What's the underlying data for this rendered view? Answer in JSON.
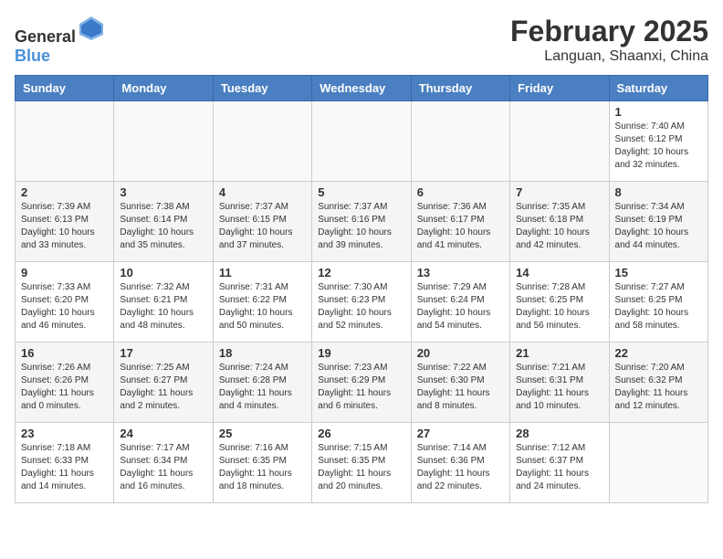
{
  "header": {
    "logo_general": "General",
    "logo_blue": "Blue",
    "title": "February 2025",
    "subtitle": "Languan, Shaanxi, China"
  },
  "weekdays": [
    "Sunday",
    "Monday",
    "Tuesday",
    "Wednesday",
    "Thursday",
    "Friday",
    "Saturday"
  ],
  "weeks": [
    [
      {
        "day": "",
        "sunrise": "",
        "sunset": "",
        "daylight": ""
      },
      {
        "day": "",
        "sunrise": "",
        "sunset": "",
        "daylight": ""
      },
      {
        "day": "",
        "sunrise": "",
        "sunset": "",
        "daylight": ""
      },
      {
        "day": "",
        "sunrise": "",
        "sunset": "",
        "daylight": ""
      },
      {
        "day": "",
        "sunrise": "",
        "sunset": "",
        "daylight": ""
      },
      {
        "day": "",
        "sunrise": "",
        "sunset": "",
        "daylight": ""
      },
      {
        "day": "1",
        "sunrise": "Sunrise: 7:40 AM",
        "sunset": "Sunset: 6:12 PM",
        "daylight": "Daylight: 10 hours and 32 minutes."
      }
    ],
    [
      {
        "day": "2",
        "sunrise": "Sunrise: 7:39 AM",
        "sunset": "Sunset: 6:13 PM",
        "daylight": "Daylight: 10 hours and 33 minutes."
      },
      {
        "day": "3",
        "sunrise": "Sunrise: 7:38 AM",
        "sunset": "Sunset: 6:14 PM",
        "daylight": "Daylight: 10 hours and 35 minutes."
      },
      {
        "day": "4",
        "sunrise": "Sunrise: 7:37 AM",
        "sunset": "Sunset: 6:15 PM",
        "daylight": "Daylight: 10 hours and 37 minutes."
      },
      {
        "day": "5",
        "sunrise": "Sunrise: 7:37 AM",
        "sunset": "Sunset: 6:16 PM",
        "daylight": "Daylight: 10 hours and 39 minutes."
      },
      {
        "day": "6",
        "sunrise": "Sunrise: 7:36 AM",
        "sunset": "Sunset: 6:17 PM",
        "daylight": "Daylight: 10 hours and 41 minutes."
      },
      {
        "day": "7",
        "sunrise": "Sunrise: 7:35 AM",
        "sunset": "Sunset: 6:18 PM",
        "daylight": "Daylight: 10 hours and 42 minutes."
      },
      {
        "day": "8",
        "sunrise": "Sunrise: 7:34 AM",
        "sunset": "Sunset: 6:19 PM",
        "daylight": "Daylight: 10 hours and 44 minutes."
      }
    ],
    [
      {
        "day": "9",
        "sunrise": "Sunrise: 7:33 AM",
        "sunset": "Sunset: 6:20 PM",
        "daylight": "Daylight: 10 hours and 46 minutes."
      },
      {
        "day": "10",
        "sunrise": "Sunrise: 7:32 AM",
        "sunset": "Sunset: 6:21 PM",
        "daylight": "Daylight: 10 hours and 48 minutes."
      },
      {
        "day": "11",
        "sunrise": "Sunrise: 7:31 AM",
        "sunset": "Sunset: 6:22 PM",
        "daylight": "Daylight: 10 hours and 50 minutes."
      },
      {
        "day": "12",
        "sunrise": "Sunrise: 7:30 AM",
        "sunset": "Sunset: 6:23 PM",
        "daylight": "Daylight: 10 hours and 52 minutes."
      },
      {
        "day": "13",
        "sunrise": "Sunrise: 7:29 AM",
        "sunset": "Sunset: 6:24 PM",
        "daylight": "Daylight: 10 hours and 54 minutes."
      },
      {
        "day": "14",
        "sunrise": "Sunrise: 7:28 AM",
        "sunset": "Sunset: 6:25 PM",
        "daylight": "Daylight: 10 hours and 56 minutes."
      },
      {
        "day": "15",
        "sunrise": "Sunrise: 7:27 AM",
        "sunset": "Sunset: 6:25 PM",
        "daylight": "Daylight: 10 hours and 58 minutes."
      }
    ],
    [
      {
        "day": "16",
        "sunrise": "Sunrise: 7:26 AM",
        "sunset": "Sunset: 6:26 PM",
        "daylight": "Daylight: 11 hours and 0 minutes."
      },
      {
        "day": "17",
        "sunrise": "Sunrise: 7:25 AM",
        "sunset": "Sunset: 6:27 PM",
        "daylight": "Daylight: 11 hours and 2 minutes."
      },
      {
        "day": "18",
        "sunrise": "Sunrise: 7:24 AM",
        "sunset": "Sunset: 6:28 PM",
        "daylight": "Daylight: 11 hours and 4 minutes."
      },
      {
        "day": "19",
        "sunrise": "Sunrise: 7:23 AM",
        "sunset": "Sunset: 6:29 PM",
        "daylight": "Daylight: 11 hours and 6 minutes."
      },
      {
        "day": "20",
        "sunrise": "Sunrise: 7:22 AM",
        "sunset": "Sunset: 6:30 PM",
        "daylight": "Daylight: 11 hours and 8 minutes."
      },
      {
        "day": "21",
        "sunrise": "Sunrise: 7:21 AM",
        "sunset": "Sunset: 6:31 PM",
        "daylight": "Daylight: 11 hours and 10 minutes."
      },
      {
        "day": "22",
        "sunrise": "Sunrise: 7:20 AM",
        "sunset": "Sunset: 6:32 PM",
        "daylight": "Daylight: 11 hours and 12 minutes."
      }
    ],
    [
      {
        "day": "23",
        "sunrise": "Sunrise: 7:18 AM",
        "sunset": "Sunset: 6:33 PM",
        "daylight": "Daylight: 11 hours and 14 minutes."
      },
      {
        "day": "24",
        "sunrise": "Sunrise: 7:17 AM",
        "sunset": "Sunset: 6:34 PM",
        "daylight": "Daylight: 11 hours and 16 minutes."
      },
      {
        "day": "25",
        "sunrise": "Sunrise: 7:16 AM",
        "sunset": "Sunset: 6:35 PM",
        "daylight": "Daylight: 11 hours and 18 minutes."
      },
      {
        "day": "26",
        "sunrise": "Sunrise: 7:15 AM",
        "sunset": "Sunset: 6:35 PM",
        "daylight": "Daylight: 11 hours and 20 minutes."
      },
      {
        "day": "27",
        "sunrise": "Sunrise: 7:14 AM",
        "sunset": "Sunset: 6:36 PM",
        "daylight": "Daylight: 11 hours and 22 minutes."
      },
      {
        "day": "28",
        "sunrise": "Sunrise: 7:12 AM",
        "sunset": "Sunset: 6:37 PM",
        "daylight": "Daylight: 11 hours and 24 minutes."
      },
      {
        "day": "",
        "sunrise": "",
        "sunset": "",
        "daylight": ""
      }
    ]
  ]
}
